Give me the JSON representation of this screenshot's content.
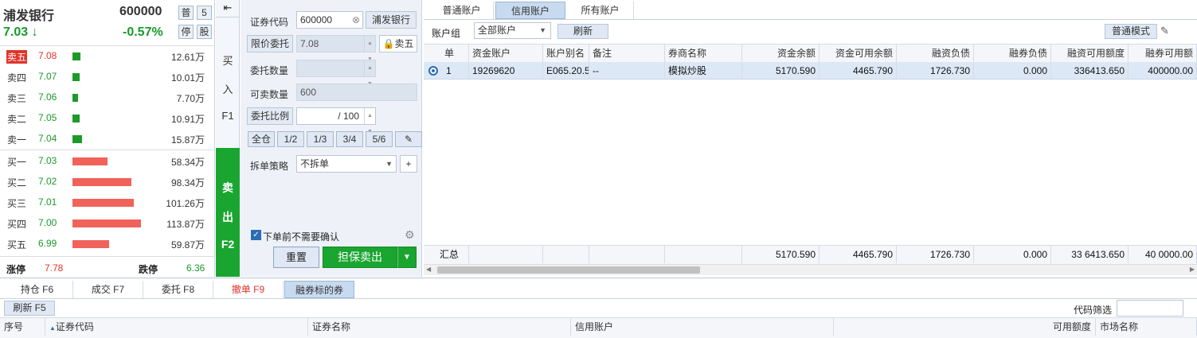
{
  "quote": {
    "name": "浦发银行",
    "code": "600000",
    "tag_normal": "普",
    "tag_five": "5",
    "tag_stop": "停",
    "tag_stock": "股",
    "price": "7.03",
    "change_pct": "-0.57%",
    "sell_levels": [
      {
        "label": "卖五",
        "price": "7.08",
        "volume": "12.61万",
        "bar": 0.12,
        "highlight": true
      },
      {
        "label": "卖四",
        "price": "7.07",
        "volume": "10.01万",
        "bar": 0.1,
        "highlight": false
      },
      {
        "label": "卖三",
        "price": "7.06",
        "volume": "7.70万",
        "bar": 0.08,
        "highlight": false
      },
      {
        "label": "卖二",
        "price": "7.05",
        "volume": "10.91万",
        "bar": 0.1,
        "highlight": false
      },
      {
        "label": "卖一",
        "price": "7.04",
        "volume": "15.87万",
        "bar": 0.14,
        "highlight": false
      }
    ],
    "buy_levels": [
      {
        "label": "买一",
        "price": "7.03",
        "volume": "58.34万",
        "bar": 0.51
      },
      {
        "label": "买二",
        "price": "7.02",
        "volume": "98.34万",
        "bar": 0.86
      },
      {
        "label": "买三",
        "price": "7.01",
        "volume": "101.26万",
        "bar": 0.89
      },
      {
        "label": "买四",
        "price": "7.00",
        "volume": "113.87万",
        "bar": 1.0
      },
      {
        "label": "买五",
        "price": "6.99",
        "volume": "59.87万",
        "bar": 0.53
      }
    ],
    "limit_up_label": "涨停",
    "limit_up": "7.78",
    "limit_down_label": "跌停",
    "limit_down": "6.36"
  },
  "strip": {
    "collapse_icon": "collapse-left-icon",
    "buy_chars": [
      "买",
      "入",
      "F1"
    ],
    "sell_chars": [
      "卖",
      "出",
      "F2"
    ]
  },
  "form": {
    "code_label": "证券代码",
    "code_value": "600000",
    "code_name": "浦发银行",
    "price_label": "限价委托",
    "price_value": "7.08",
    "lock_label": "卖五",
    "qty_label": "委托数量",
    "qty_value": "",
    "sellable_label": "可卖数量",
    "sellable_value": "600",
    "ratio_label": "委托比例",
    "ratio_value": "/  100",
    "ratio_buttons": [
      "全仓",
      "1/2",
      "1/3",
      "3/4",
      "5/6"
    ],
    "split_label": "拆单策略",
    "split_value": "不拆单",
    "confirm_label": "下单前不需要确认",
    "confirm_checked": true,
    "reset_label": "重置",
    "submit_label": "担保卖出"
  },
  "account": {
    "tabs": [
      "普通账户",
      "信用账户",
      "所有账户"
    ],
    "active_tab": 1,
    "group_label": "账户组",
    "group_value": "全部账户",
    "refresh_label": "刷新",
    "mode_label": "普通模式",
    "columns": [
      "单",
      "资金账户",
      "账户别名",
      "备注",
      "券商名称",
      "资金余额",
      "资金可用余额",
      "融资负债",
      "融券负债",
      "融资可用额度",
      "融券可用额"
    ],
    "rows": [
      [
        "1",
        "19269620",
        "E065.20.5",
        "--",
        "模拟炒股",
        "5170.590",
        "4465.790",
        "1726.730",
        "0.000",
        "336413.650",
        "400000.00"
      ]
    ],
    "footer": [
      "汇总",
      "",
      "",
      "",
      "",
      "5170.590",
      "4465.790",
      "1726.730",
      "0.000",
      "33 6413.650",
      "40 0000.00"
    ]
  },
  "bottom": {
    "tabs": [
      "持仓 F6",
      "成交 F7",
      "委托 F8",
      "撤单 F9",
      "融券标的券"
    ],
    "active_tab": 4,
    "refresh_label": "刷新 F5",
    "filter_label": "代码筛选",
    "filter_value": "",
    "columns": [
      "序号",
      "证券代码",
      "证券名称",
      "信用账户",
      "可用额度",
      "市场名称"
    ]
  },
  "colors": {
    "green": "#1a9a2a",
    "red": "#e0352b",
    "sell_green": "#1aa530",
    "accent_blue": "#c7daf0"
  }
}
